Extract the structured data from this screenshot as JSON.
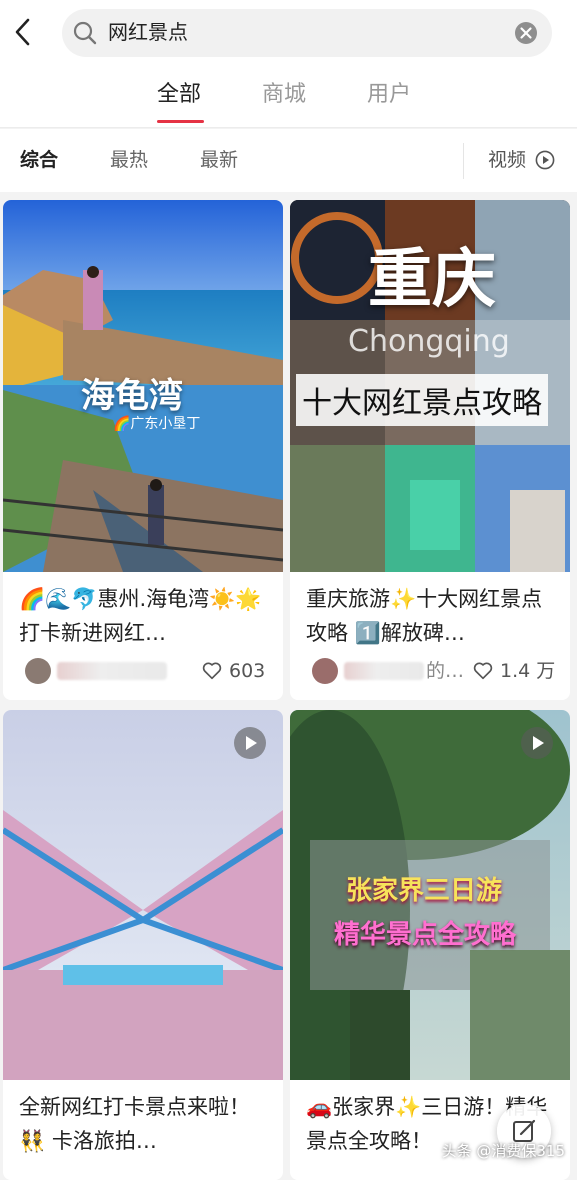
{
  "search": {
    "query": "网红景点"
  },
  "tabs": [
    {
      "label": "全部",
      "active": true
    },
    {
      "label": "商城",
      "active": false
    },
    {
      "label": "用户",
      "active": false
    }
  ],
  "filters": [
    {
      "label": "综合",
      "active": true
    },
    {
      "label": "最热",
      "active": false
    },
    {
      "label": "最新",
      "active": false
    }
  ],
  "video_filter": {
    "label": "视频"
  },
  "cards": [
    {
      "image_text": "海龟湾",
      "image_subtext": "🌈广东小垦丁",
      "title": "🌈🌊🐬惠州.海龟湾☀️🌟打卡新进网红…",
      "likes": "603",
      "is_video": false
    },
    {
      "image_text": "重庆",
      "image_subtext": "Chongqing",
      "image_caption": "十大网红景点攻略",
      "title": "重庆旅游✨十大网红景点攻略 1️⃣解放碑…",
      "author_suffix": "的…",
      "likes": "1.4 万",
      "is_video": false
    },
    {
      "title": "全新网红打卡景点来啦！👯 卡洛旅拍…",
      "is_video": true
    },
    {
      "image_text": "张家界三日游",
      "image_caption": "精华景点全攻略",
      "title": "🚗张家界✨三日游！精华景点全攻略！",
      "is_video": true
    }
  ],
  "watermark": "头条 @消费保315",
  "colors": {
    "accent": "#e53244",
    "bg": "#f3f3f3"
  }
}
